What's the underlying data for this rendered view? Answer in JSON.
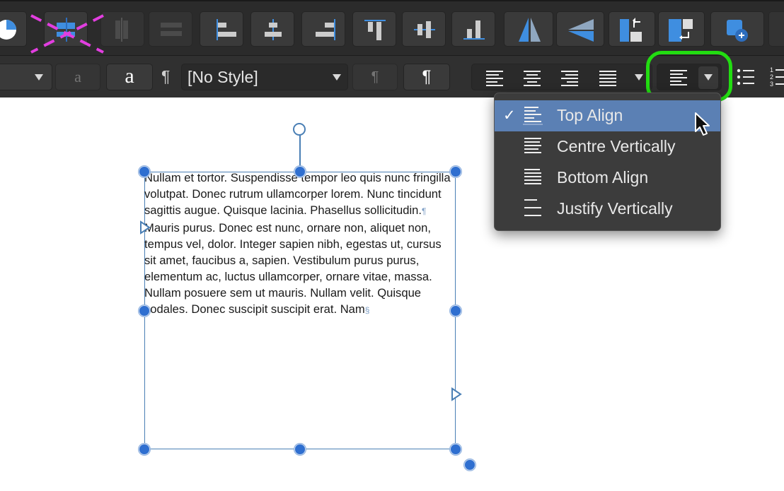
{
  "toolbar_top": {
    "buttons": [
      {
        "name": "arrange-pie-button"
      },
      {
        "name": "distribute-horizontally-button"
      },
      {
        "name": "distribute-vertically-button"
      },
      {
        "name": "space-evenly-button"
      },
      {
        "name": "align-left-button"
      },
      {
        "name": "align-centre-button"
      },
      {
        "name": "align-right-button"
      },
      {
        "name": "align-top-button"
      },
      {
        "name": "align-middle-button"
      },
      {
        "name": "align-bottom-button"
      },
      {
        "name": "flip-horizontal-button"
      },
      {
        "name": "flip-vertical-button"
      },
      {
        "name": "move-back-button"
      },
      {
        "name": "move-forward-button"
      },
      {
        "name": "add-shape-button"
      }
    ]
  },
  "toolbar_text": {
    "char_style_glyph": "a",
    "char_style_glyph_dim": "a",
    "para_mark": "¶",
    "paragraph_style_value": "[No Style]",
    "para_mark_dim": "¶",
    "para_mark_button": "¶"
  },
  "document": {
    "paragraph1": "Nullam et tortor. Suspendisse tempor leo quis nunc fringilla volutpat. Donec rutrum ullamcorper lorem. Nunc tincidunt sagittis augue. Quisque lacinia. Phasellus sollicitudin.",
    "pilcrow": "¶",
    "paragraph2": "Mauris purus. Donec est nunc, ornare non, aliquet non, tempus vel, dolor. Integer sapien nibh, egestas ut, cursus sit amet, faucibus a, sapien. Vestibulum purus purus, elementum ac, luctus ullamcorper, ornare vitae, massa. Nullam posuere sem ut mauris. Nullam velit. Quisque sodales. Donec suscipit suscipit erat. Nam",
    "section_mark": "§"
  },
  "vertical_align_menu": {
    "items": [
      {
        "label": "Top Align",
        "selected": true,
        "check": "✓"
      },
      {
        "label": "Centre Vertically",
        "selected": false
      },
      {
        "label": "Bottom Align",
        "selected": false
      },
      {
        "label": "Justify Vertically",
        "selected": false
      }
    ]
  },
  "colors": {
    "toolbar_bg": "#2b2b2b",
    "button_bg": "#3a3a3a",
    "icon_blue": "#3f8ee0",
    "menu_selected": "#5b80b4",
    "highlight_green": "#22dd11",
    "annotation_magenta": "#e23ee0",
    "frame_blue": "#4a7fb5"
  }
}
